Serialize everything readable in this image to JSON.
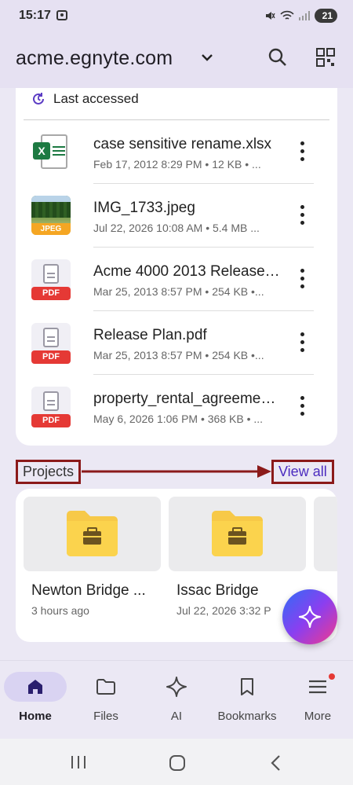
{
  "status_bar": {
    "time": "15:17",
    "battery": "21"
  },
  "header": {
    "title": "acme.egnyte.com"
  },
  "recent": {
    "section_label": "Last accessed",
    "files": [
      {
        "name": "case sensitive rename.xlsx",
        "meta": "Feb 17, 2012 8:29 PM • 12 KB • ...",
        "type": "xlsx"
      },
      {
        "name": "IMG_1733.jpeg",
        "meta": "Jul 22, 2026 10:08 AM • 5.4 MB ...",
        "type": "jpeg",
        "badge": "JPEG"
      },
      {
        "name": "Acme 4000 2013 Release Plan.pdf",
        "meta": "Mar 25, 2013 8:57 PM • 254 KB •...",
        "type": "pdf",
        "badge": "PDF"
      },
      {
        "name": "Release Plan.pdf",
        "meta": "Mar 25, 2013 8:57 PM • 254 KB •...",
        "type": "pdf",
        "badge": "PDF"
      },
      {
        "name": "property_rental_agreement.pdf",
        "meta": "May 6, 2026 1:06 PM • 368 KB • ...",
        "type": "pdf",
        "badge": "PDF"
      }
    ]
  },
  "projects": {
    "section_label": "Projects",
    "view_all_label": "View all",
    "items": [
      {
        "name": "Newton Bridge ...",
        "time": "3 hours ago"
      },
      {
        "name": "Issac Bridge",
        "time": "Jul 22, 2026 3:32 P"
      }
    ]
  },
  "bottom_nav": [
    {
      "label": "Home",
      "icon": "home-icon",
      "active": true
    },
    {
      "label": "Files",
      "icon": "folder-icon"
    },
    {
      "label": "AI",
      "icon": "sparkle-icon"
    },
    {
      "label": "Bookmarks",
      "icon": "bookmark-icon"
    },
    {
      "label": "More",
      "icon": "menu-icon"
    }
  ],
  "colors": {
    "accent": "#4b2bbf",
    "annotation": "#8b1a1a",
    "header_bg": "#e6e1f2",
    "pdf_red": "#e53935",
    "excel_green": "#1d7a42",
    "jpeg_orange": "#f5a623"
  }
}
